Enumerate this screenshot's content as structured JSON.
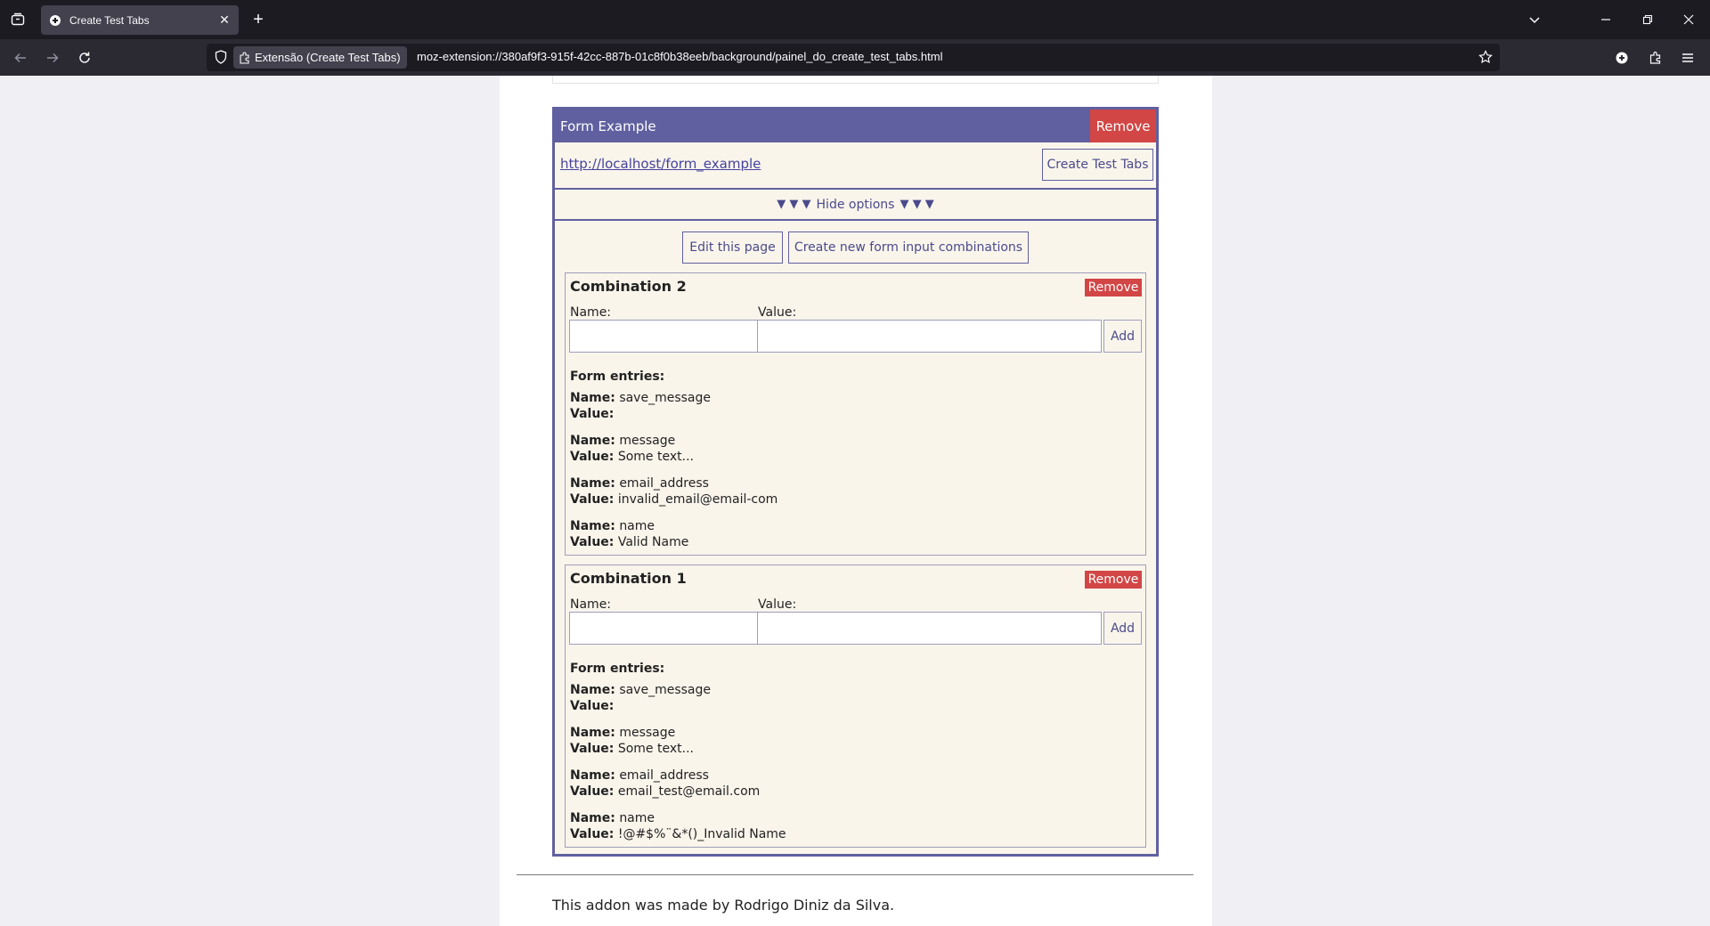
{
  "browser": {
    "tab": {
      "title": "Create Test Tabs",
      "favicon": "extension-puzzle-icon"
    },
    "url_chip": "Extensão (Create Test Tabs)",
    "url": "moz-extension://380af9f3-915f-42cc-887b-01c8f0b38eeb/background/painel_do_create_test_tabs.html"
  },
  "card": {
    "title": "Form Example",
    "remove_label": "Remove",
    "link": "http://localhost/form_example",
    "create_tabs_label": "Create Test Tabs",
    "toggle_arrows": "▼ ▼ ▼",
    "toggle_label": "Hide options",
    "edit_page_label": "Edit this page",
    "new_combo_label": "Create new form input combinations"
  },
  "combinations": [
    {
      "title": "Combination 2",
      "remove_label": "Remove",
      "name_label": "Name:",
      "value_label": "Value:",
      "add_label": "Add",
      "entries_heading": "Form entries:",
      "entries": [
        {
          "name": "save_message",
          "value": ""
        },
        {
          "name": "message",
          "value": "Some text..."
        },
        {
          "name": "email_address",
          "value": "invalid_email@email-com"
        },
        {
          "name": "name",
          "value": "Valid Name"
        }
      ]
    },
    {
      "title": "Combination 1",
      "remove_label": "Remove",
      "name_label": "Name:",
      "value_label": "Value:",
      "add_label": "Add",
      "entries_heading": "Form entries:",
      "entries": [
        {
          "name": "save_message",
          "value": ""
        },
        {
          "name": "message",
          "value": "Some text..."
        },
        {
          "name": "email_address",
          "value": "email_test@email.com"
        },
        {
          "name": "name",
          "value": "!@#$%¨&*()_Invalid Name"
        }
      ]
    }
  ],
  "labels": {
    "name_key": "Name:",
    "value_key": "Value:"
  },
  "footer": {
    "credit": "This addon was made by Rodrigo Diniz da Silva."
  },
  "colors": {
    "accent": "#6060a0",
    "remove": "#d24646",
    "card_bg": "#faf5eb"
  }
}
